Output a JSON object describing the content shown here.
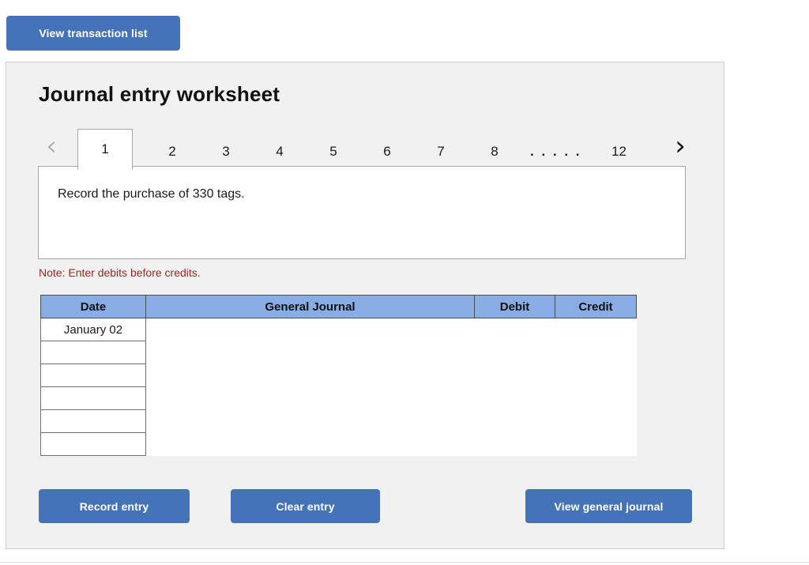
{
  "top_actions": {
    "view_transaction_list_label": "View transaction list"
  },
  "panel": {
    "title": "Journal entry worksheet",
    "note": "Note: Enter debits before credits.",
    "description": "Record the purchase of 330 tags."
  },
  "tabs": {
    "prev_icon": "chevron-left-icon",
    "next_icon": "chevron-right-icon",
    "prev_glyph": "‹",
    "next_glyph": "›",
    "items": [
      {
        "label": "1",
        "active": true
      },
      {
        "label": "2",
        "active": false
      },
      {
        "label": "3",
        "active": false
      },
      {
        "label": "4",
        "active": false
      },
      {
        "label": "5",
        "active": false
      },
      {
        "label": "6",
        "active": false
      },
      {
        "label": "7",
        "active": false
      },
      {
        "label": "8",
        "active": false
      }
    ],
    "ellipsis": ". . . . .",
    "last": {
      "label": "12",
      "active": false
    }
  },
  "journal_table": {
    "columns": [
      "Date",
      "General Journal",
      "Debit",
      "Credit"
    ],
    "rows": [
      {
        "date": "January 02",
        "general_journal": "",
        "debit": "",
        "credit": ""
      },
      {
        "date": "",
        "general_journal": "",
        "debit": "",
        "credit": ""
      },
      {
        "date": "",
        "general_journal": "",
        "debit": "",
        "credit": ""
      },
      {
        "date": "",
        "general_journal": "",
        "debit": "",
        "credit": ""
      },
      {
        "date": "",
        "general_journal": "",
        "debit": "",
        "credit": ""
      },
      {
        "date": "",
        "general_journal": "",
        "debit": "",
        "credit": ""
      }
    ]
  },
  "footer_actions": {
    "record_entry_label": "Record entry",
    "clear_entry_label": "Clear entry",
    "view_general_journal_label": "View general journal"
  },
  "colors": {
    "accent_blue": "#4573b7",
    "header_blue": "#87ade4",
    "note_red": "#9c2722",
    "panel_bg": "#f1f1f1"
  }
}
